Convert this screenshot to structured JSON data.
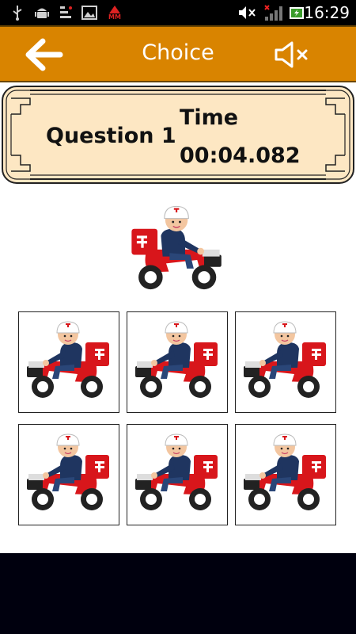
{
  "status_bar": {
    "time": "16:29",
    "left_icons": [
      "usb-icon",
      "android-debug-icon",
      "file-transfer-icon",
      "image-icon",
      "mm-app-icon"
    ],
    "mm_label": "MM",
    "right_icons": [
      "muted-speaker-icon",
      "signal-icon",
      "battery-icon"
    ]
  },
  "header": {
    "title": "Choice",
    "back_icon": "arrow-left-icon",
    "sound_icon": "speaker-muted-icon",
    "bar_color": "#d98400"
  },
  "info_panel": {
    "question_label": "Question 1",
    "time_label": "Time",
    "time_value": "00:04.082",
    "panel_color": "#fde7c3"
  },
  "target": {
    "image": "postman-scooter-facing-right"
  },
  "choices": [
    {
      "image": "postman-scooter-facing-left-smiling"
    },
    {
      "image": "postman-scooter-facing-left-worried"
    },
    {
      "image": "postman-scooter-facing-left-smiling"
    },
    {
      "image": "postman-scooter-facing-left-smiling"
    },
    {
      "image": "postman-scooter-facing-left-smiling"
    },
    {
      "image": "postman-scooter-facing-left-smiling"
    }
  ]
}
